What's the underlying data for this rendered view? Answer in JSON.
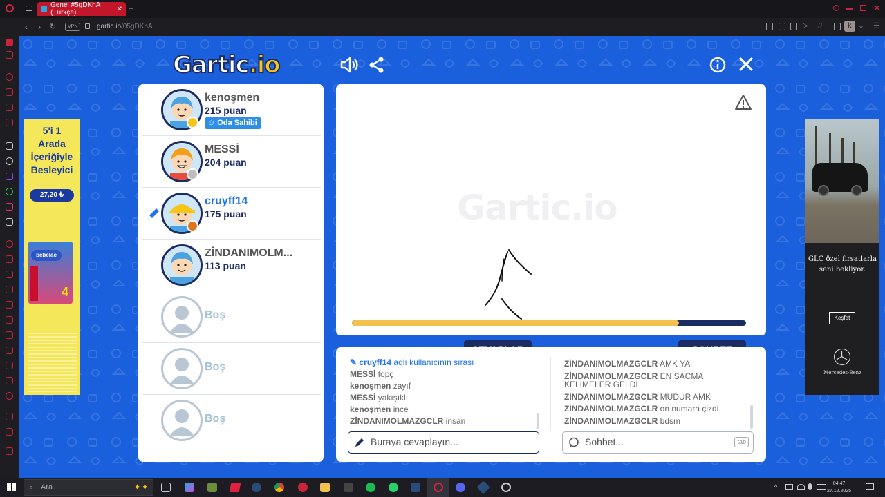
{
  "browser": {
    "tab_title": "Genel #5gDKhA (Türkçe)",
    "url_host": "gartic.io",
    "url_path": "/05gDKhA",
    "vpn_label": "VPN",
    "profile_initial": "k"
  },
  "game": {
    "logo_main": "Gartic",
    "logo_suffix": ".io",
    "top_icons": [
      "speaker-icon",
      "share-icon",
      "info-icon",
      "close-icon"
    ],
    "players": [
      {
        "name": "kenoşmen",
        "points": "215 puan",
        "badge": "Oda Sahibi",
        "status_color": "#f5c518",
        "hair": "#4aa3e0",
        "drawing": false
      },
      {
        "name": "MESSİ",
        "points": "204 puan",
        "badge": "",
        "status_color": "#bdbdbd",
        "hair": "#f0a01a",
        "drawing": false
      },
      {
        "name": "cruyff14",
        "points": "175 puan",
        "badge": "",
        "status_color": "#e0731e",
        "hair": "#f5c518",
        "drawing": true
      },
      {
        "name": "ZİNDANIMOLM...",
        "points": "113 puan",
        "badge": "",
        "status_color": "",
        "hair": "#4aa3e0",
        "drawing": false
      }
    ],
    "empty_slot_label": "Boş",
    "empty_slots": 3,
    "timer_progress": 0.83,
    "tabs": {
      "answers": "CEVAPLAR",
      "chat": "SOHBET"
    },
    "answers": [
      {
        "user": "cruyff14",
        "text": "adlı kullanıcının sırası",
        "system": true
      },
      {
        "user": "MESSİ",
        "text": "topç"
      },
      {
        "user": "kenoşmen",
        "text": "zayıf"
      },
      {
        "user": "MESSİ",
        "text": "yakışıklı"
      },
      {
        "user": "kenoşmen",
        "text": "ince"
      },
      {
        "user": "ZİNDANIMOLMAZGCLR",
        "text": "insan"
      }
    ],
    "chat": [
      {
        "user": "ZİNDANIMOLMAZGCLR",
        "text": "AMK YA"
      },
      {
        "user": "ZİNDANIMOLMAZGCLR",
        "text": "EN SACMA KELİMELER GELDİ"
      },
      {
        "user": "ZİNDANIMOLMAZGCLR",
        "text": "MUDUR AMK"
      },
      {
        "user": "ZİNDANIMOLMAZGCLR",
        "text": "on numara çizdi"
      },
      {
        "user": "ZİNDANIMOLMAZGCLR",
        "text": "bdsm"
      }
    ],
    "answer_placeholder": "Buraya cevaplayın...",
    "chat_placeholder": "Sohbet...",
    "chat_hint": "tab"
  },
  "ads": {
    "left": {
      "headline": [
        "5'i 1",
        "Arada",
        "İçeriğiyle",
        "Besleyici"
      ],
      "price": "27,20 ₺",
      "brand": "bebelac",
      "box_number": "4"
    },
    "right": {
      "text": "GLC özel fırsatlarla seni bekliyor.",
      "button": "Keşfet",
      "brand": "Mercedes-Benz"
    }
  },
  "taskbar": {
    "search_label": "Ara",
    "time": "04:47",
    "date": "27.12.2025"
  }
}
